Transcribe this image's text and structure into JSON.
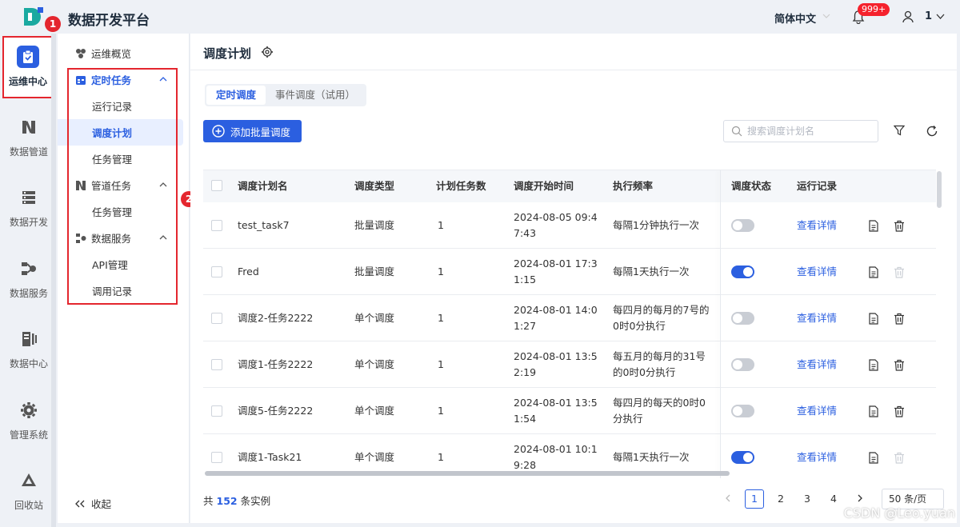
{
  "app": {
    "title": "数据开发平台"
  },
  "header": {
    "language": "简体中文",
    "notifications_badge": "999+",
    "user_label": "1"
  },
  "markers": [
    "1",
    "2"
  ],
  "rail": [
    {
      "label": "运维中心",
      "icon": "clipboard-check-icon",
      "active": true
    },
    {
      "label": "数据管道",
      "icon": "pipeline-icon"
    },
    {
      "label": "数据开发",
      "icon": "dev-icon"
    },
    {
      "label": "数据服务",
      "icon": "service-icon"
    },
    {
      "label": "数据中心",
      "icon": "data-center-icon"
    },
    {
      "label": "管理系统",
      "icon": "gear-icon"
    },
    {
      "label": "回收站",
      "icon": "recycle-icon"
    }
  ],
  "sidebar": {
    "overview": "运维概览",
    "groups": [
      {
        "label": "定时任务",
        "children": [
          "运行记录",
          "调度计划",
          "任务管理"
        ]
      },
      {
        "label": "管道任务",
        "children": [
          "任务管理"
        ]
      },
      {
        "label": "数据服务",
        "children": [
          "API管理",
          "调用记录"
        ]
      }
    ],
    "collapse": "收起"
  },
  "main": {
    "title": "调度计划",
    "tabs": [
      "定时调度",
      "事件调度（试用）"
    ],
    "add_button": "添加批量调度",
    "search_placeholder": "搜索调度计划名"
  },
  "table": {
    "columns": [
      "调度计划名",
      "调度类型",
      "计划任务数",
      "调度开始时间",
      "执行频率",
      "调度状态",
      "运行记录"
    ],
    "rows": [
      {
        "name": "test_task7",
        "type": "批量调度",
        "count": "1",
        "start1": "2024-08-05 09:4",
        "start2": "7:43",
        "freq1": "每隔1分钟执行一次",
        "freq2": "",
        "enabled": false,
        "link": "查看详情",
        "delete_enabled": true
      },
      {
        "name": "Fred",
        "type": "批量调度",
        "count": "1",
        "start1": "2024-08-01 17:3",
        "start2": "1:15",
        "freq1": "每隔1天执行一次",
        "freq2": "",
        "enabled": true,
        "link": "查看详情",
        "delete_enabled": false
      },
      {
        "name": "调度2-任务2222",
        "type": "单个调度",
        "count": "1",
        "start1": "2024-08-01 14:0",
        "start2": "1:27",
        "freq1": "每四月的每月的7号的",
        "freq2": "0时0分执行",
        "enabled": false,
        "link": "查看详情",
        "delete_enabled": true
      },
      {
        "name": "调度1-任务2222",
        "type": "单个调度",
        "count": "1",
        "start1": "2024-08-01 13:5",
        "start2": "2:19",
        "freq1": "每五月的每月的31号",
        "freq2": "的0时0分执行",
        "enabled": false,
        "link": "查看详情",
        "delete_enabled": true
      },
      {
        "name": "调度5-任务2222",
        "type": "单个调度",
        "count": "1",
        "start1": "2024-08-01 13:5",
        "start2": "1:54",
        "freq1": "每四月的每天的0时0",
        "freq2": "分执行",
        "enabled": false,
        "link": "查看详情",
        "delete_enabled": true
      },
      {
        "name": "调度1-Task21",
        "type": "单个调度",
        "count": "1",
        "start1": "2024-08-01 10:1",
        "start2": "9:28",
        "freq1": "每隔1天执行一次",
        "freq2": "",
        "enabled": true,
        "link": "查看详情",
        "delete_enabled": false
      }
    ]
  },
  "pagination": {
    "total_prefix": "共",
    "total": "152",
    "total_suffix": "条实例",
    "pages": [
      "1",
      "2",
      "3",
      "4"
    ],
    "current": "1",
    "page_size": "50 条/页"
  },
  "watermark": "CSDN @Leo.yuan",
  "colors": {
    "primary": "#2b5fe0",
    "marker": "#e4262e"
  }
}
